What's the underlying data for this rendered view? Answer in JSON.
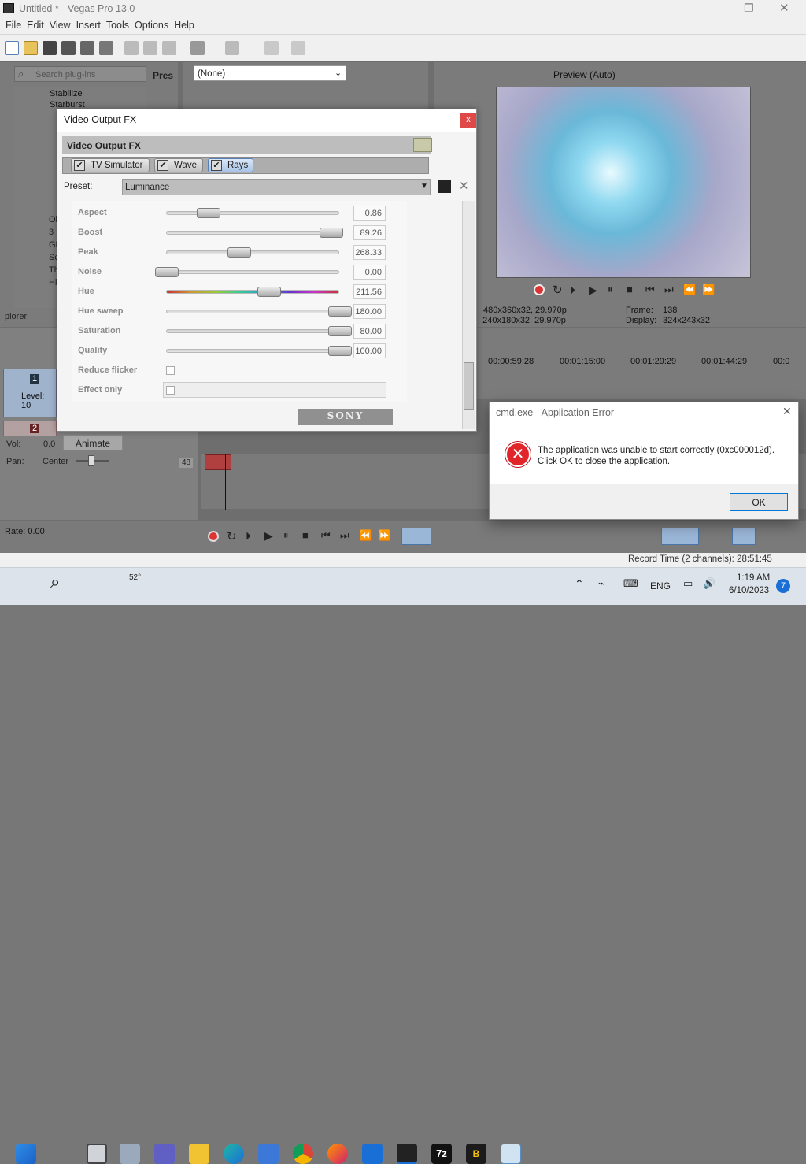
{
  "window": {
    "title": "Untitled * - Vegas Pro 13.0",
    "min": "—",
    "max": "❐",
    "close": "✕"
  },
  "menu": [
    "File",
    "Edit",
    "View",
    "Insert",
    "Tools",
    "Options",
    "Help"
  ],
  "plugins": {
    "search_placeholder": "Search plug-ins",
    "tab_label": "Pres",
    "tree_items": [
      "Stabilize",
      "Starburst"
    ],
    "folder_items": [
      "Ol",
      "3",
      "GF",
      "Sc",
      "Th",
      "Hi"
    ],
    "explorer_tab": "plorer"
  },
  "fx_chain_dropdown": "(None)",
  "preview": {
    "mode": "Preview (Auto)",
    "info_left_1": "480x360x32, 29.970p",
    "info_left_2": ": 240x180x32, 29.970p",
    "frame_label": "Frame:",
    "frame_value": "138",
    "display_label": "Display:",
    "display_value": "324x243x32"
  },
  "timeline": {
    "ticks": [
      "00:00:59:28",
      "00:01:15:00",
      "00:01:29:29",
      "00:01:44:29",
      "00:0"
    ],
    "marker": "48",
    "rate_label": "Rate: 0.00",
    "record_time": "Record Time (2 channels): 28:51:45"
  },
  "tracks": {
    "track1_num": "1",
    "track1_level": "Level: 10",
    "track2_num": "2",
    "vol_label": "Vol:",
    "vol_value": "0.0",
    "pan_label": "Pan:",
    "pan_value": "Center",
    "animate": "Animate"
  },
  "fx_dialog": {
    "title": "Video Output FX",
    "close": "x",
    "header": "Video Output FX",
    "chain": [
      "TV Simulator",
      "Wave",
      "Rays"
    ],
    "preset_label": "Preset:",
    "preset_value": "Luminance",
    "brand": "SONY",
    "params": [
      {
        "label": "Aspect",
        "value": "0.86",
        "level": 0.24,
        "kind": "slider"
      },
      {
        "label": "Boost",
        "value": "89.26",
        "level": 0.95,
        "kind": "slider"
      },
      {
        "label": "Peak",
        "value": "268.33",
        "level": 0.42,
        "kind": "slider"
      },
      {
        "label": "Noise",
        "value": "0.00",
        "level": 0.0,
        "kind": "slider"
      },
      {
        "label": "Hue",
        "value": "211.56",
        "level": 0.59,
        "kind": "hue"
      },
      {
        "label": "Hue sweep",
        "value": "180.00",
        "level": 1.0,
        "kind": "slider"
      },
      {
        "label": "Saturation",
        "value": "80.00",
        "level": 1.0,
        "kind": "slider"
      },
      {
        "label": "Quality",
        "value": "100.00",
        "level": 1.0,
        "kind": "slider"
      },
      {
        "label": "Reduce flicker",
        "kind": "checkbox"
      },
      {
        "label": "Effect only",
        "kind": "checkbox"
      }
    ]
  },
  "error_dialog": {
    "title": "cmd.exe - Application Error",
    "close": "✕",
    "message_1": "The application was unable to start correctly (0xc000012d).",
    "message_2": "Click OK to close the application.",
    "ok": "OK"
  },
  "taskbar": {
    "weather": "52°",
    "lang": "ENG",
    "time": "1:19 AM",
    "date": "6/10/2023",
    "notif_count": "7",
    "apps": [
      "start",
      "search",
      "task-view",
      "weather",
      "teams",
      "explorer",
      "edge",
      "store",
      "chrome",
      "firefox",
      "defender",
      "vegas",
      "7zip",
      "b-app",
      "notepad"
    ]
  },
  "colors": {
    "accent": "#1a6fd6",
    "error_red": "#e0262b",
    "preview_cyan": "#8fd8f0"
  }
}
